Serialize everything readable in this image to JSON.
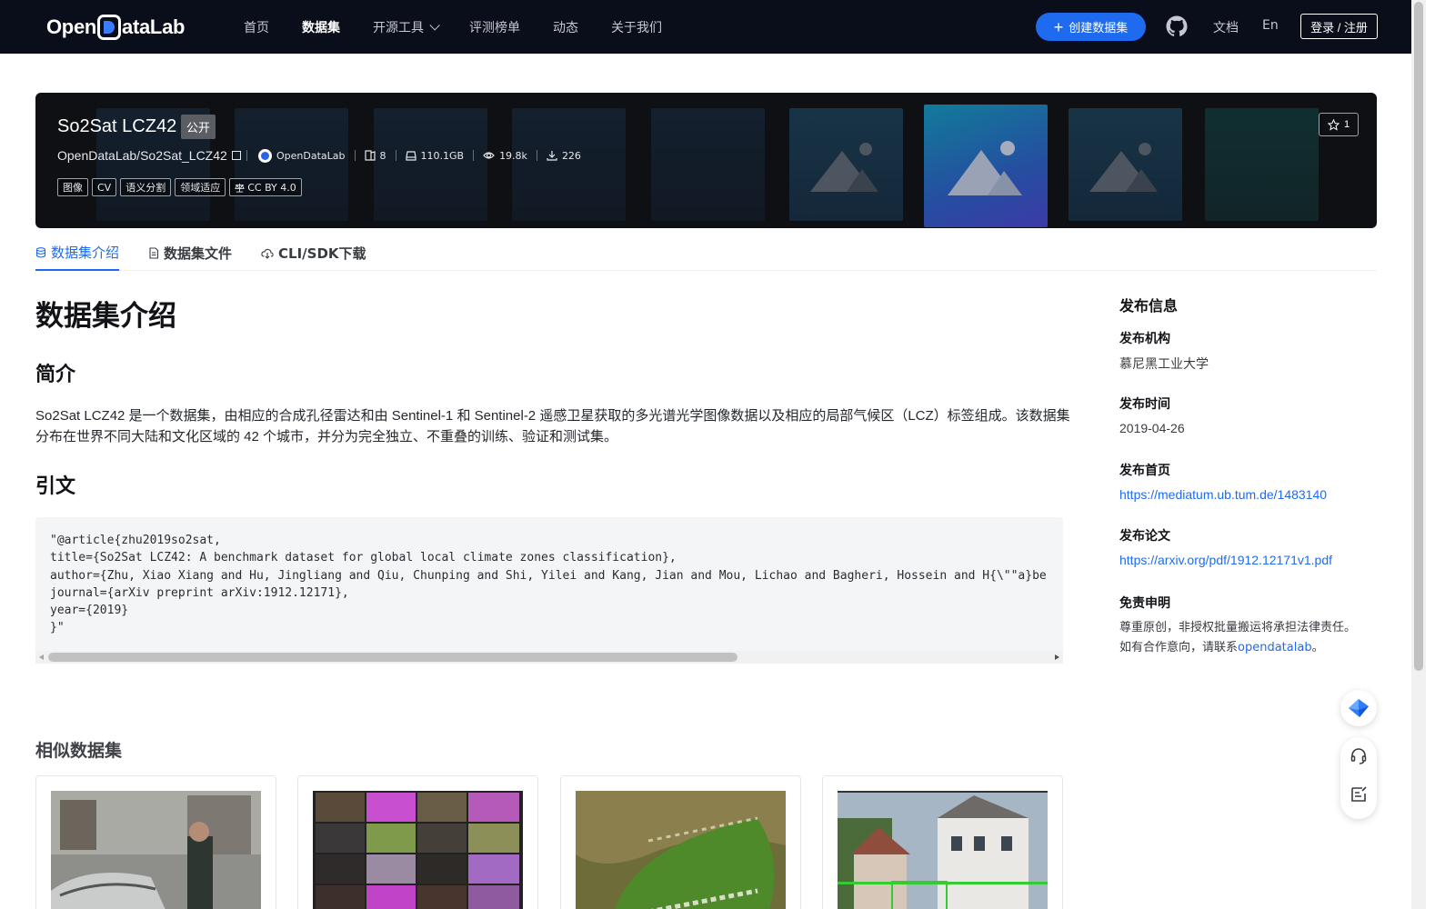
{
  "nav": {
    "logo": "OpenDataLab",
    "items": [
      "首页",
      "数据集",
      "开源工具",
      "评测榜单",
      "动态",
      "关于我们"
    ],
    "create_label": "创建数据集",
    "docs": "文档",
    "lang": "En",
    "login": "登录 / 注册"
  },
  "dataset": {
    "title": "So2Sat LCZ42",
    "visibility": "公开",
    "path": "OpenDataLab/So2Sat_LCZ42",
    "org": "OpenDataLab",
    "files": "8",
    "size": "110.1GB",
    "views": "19.8k",
    "downloads": "226",
    "tags": [
      "图像",
      "CV",
      "语义分割",
      "领域适应"
    ],
    "license": "CC BY 4.0",
    "stars": "1"
  },
  "tabs": [
    "数据集介绍",
    "数据集文件",
    "CLI/SDK下载"
  ],
  "content": {
    "heading": "数据集介绍",
    "intro_title": "简介",
    "intro_text": "So2Sat LCZ42 是一个数据集，由相应的合成孔径雷达和由 Sentinel-1 和 Sentinel-2 遥感卫星获取的多光谱光学图像数据以及相应的局部气候区（LCZ）标签组成。该数据集分布在世界不同大陆和文化区域的 42 个城市，并分为完全独立、不重叠的训练、验证和测试集。",
    "citation_title": "引文",
    "citation": "\"@article{zhu2019so2sat,\ntitle={So2Sat LCZ42: A benchmark dataset for global local climate zones classification},\nauthor={Zhu, Xiao Xiang and Hu, Jingliang and Qiu, Chunping and Shi, Yilei and Kang, Jian and Mou, Lichao and Bagheri, Hossein and H{\\\"\"a}be\njournal={arXiv preprint arXiv:1912.12171},\nyear={2019}\n}\"",
    "similar_title": "相似数据集"
  },
  "sidebar": {
    "title": "发布信息",
    "org_label": "发布机构",
    "org_value": "慕尼黑工业大学",
    "date_label": "发布时间",
    "date_value": "2019-04-26",
    "home_label": "发布首页",
    "home_value": "https://mediatum.ub.tum.de/1483140",
    "paper_label": "发布论文",
    "paper_value": "https://arxiv.org/pdf/1912.12171v1.pdf",
    "disclaimer_label": "免责申明",
    "disclaimer_line1": "尊重原创，非授权批量搬运将承担法律责任。",
    "disclaimer_line2": "如有合作意向，请联系",
    "disclaimer_link": "opendatalab",
    "disclaimer_end": "。"
  },
  "colors": {
    "accent": "#1f6bf0",
    "nav_bg": "#0a0e1a"
  }
}
